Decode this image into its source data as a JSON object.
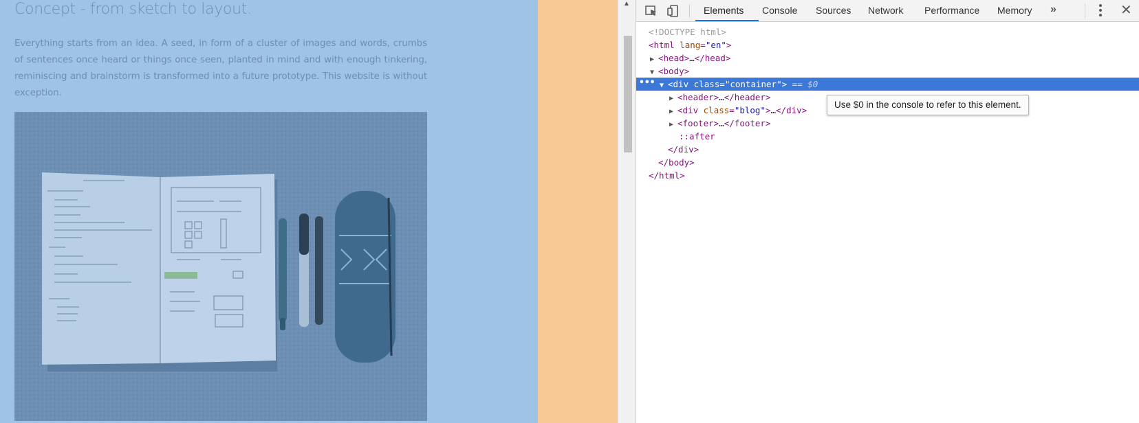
{
  "page": {
    "title": "Concept - from sketch to layout.",
    "paragraph": "Everything starts from an idea. A seed, in form of a cluster of images and words, crumbs of sentences once heard or things once seen, planted in mind and with enough tinkering, reminiscing and brainstorm is transformed into a future prototype. This website is without exception.",
    "photo_alt": "Notebook with sketches, pens and a pencil case",
    "colors": {
      "content_overlay": "#9ec3e6",
      "margin_overlay": "#f8c995",
      "text": "#6f8fae"
    }
  },
  "devtools": {
    "tabs": [
      {
        "label": "Elements",
        "active": true
      },
      {
        "label": "Console"
      },
      {
        "label": "Sources"
      },
      {
        "label": "Network"
      },
      {
        "label": "Performance"
      },
      {
        "label": "Memory"
      }
    ],
    "more_tabs": "»",
    "icons": [
      "inspect-element-icon",
      "device-toolbar-icon",
      "kebab-menu-icon",
      "close-icon"
    ],
    "dom": {
      "doctype": "<!DOCTYPE html>",
      "html_open": {
        "tag": "<html",
        "attr": "lang",
        "value": "\"en\"",
        "close": ">"
      },
      "head": {
        "open": "<head>",
        "ellipsis": "…",
        "close": "</head>"
      },
      "body_open": "<body>",
      "selected": {
        "open": "<div",
        "attr": "class",
        "value": "\"container\"",
        "close": ">",
        "marker": "== $0",
        "dots": "•••"
      },
      "header": {
        "open": "<header>",
        "ellipsis": "…",
        "close": "</header>"
      },
      "blog": {
        "open": "<div",
        "attr": "class",
        "value": "\"blog\"",
        "close": ">",
        "ellipsis": "…",
        "end": "</div>"
      },
      "footer": {
        "open": "<footer>",
        "ellipsis": "…",
        "close": "</footer>"
      },
      "after": "::after",
      "div_close": "</div>",
      "body_close": "</body>",
      "html_close": "</html>"
    },
    "tooltip": "Use $0 in the console to refer to this element."
  }
}
